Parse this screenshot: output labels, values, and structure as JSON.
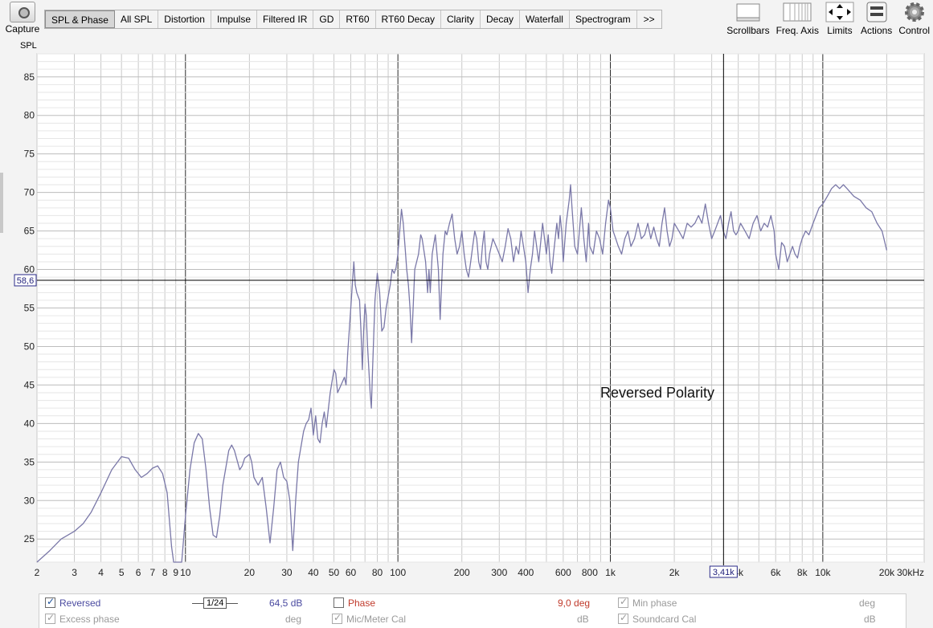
{
  "toolbar": {
    "capture_label": "Capture",
    "tabs": [
      "SPL & Phase",
      "All SPL",
      "Distortion",
      "Impulse",
      "Filtered IR",
      "GD",
      "RT60",
      "RT60 Decay",
      "Clarity",
      "Decay",
      "Waterfall",
      "Spectrogram"
    ],
    "more_label": ">>",
    "right": {
      "scrollbars": "Scrollbars",
      "freq_axis": "Freq. Axis",
      "limits": "Limits",
      "actions": "Actions",
      "control": "Control"
    }
  },
  "chart_data": {
    "type": "line",
    "ylabel": "SPL",
    "x_scale": "log",
    "xlim": [
      2,
      30000
    ],
    "ylim": [
      22,
      88
    ],
    "y_ticks": [
      25,
      30,
      35,
      40,
      45,
      50,
      55,
      60,
      65,
      70,
      75,
      80,
      85
    ],
    "x_tick_labels": [
      {
        "v": 2,
        "t": "2"
      },
      {
        "v": 3,
        "t": "3"
      },
      {
        "v": 4,
        "t": "4"
      },
      {
        "v": 5,
        "t": "5"
      },
      {
        "v": 6,
        "t": "6"
      },
      {
        "v": 7,
        "t": "7"
      },
      {
        "v": 8,
        "t": "8"
      },
      {
        "v": 9,
        "t": "9"
      },
      {
        "v": 10,
        "t": "10"
      },
      {
        "v": 20,
        "t": "20"
      },
      {
        "v": 30,
        "t": "30"
      },
      {
        "v": 40,
        "t": "40"
      },
      {
        "v": 50,
        "t": "50"
      },
      {
        "v": 60,
        "t": "60"
      },
      {
        "v": 80,
        "t": "80"
      },
      {
        "v": 100,
        "t": "100"
      },
      {
        "v": 200,
        "t": "200"
      },
      {
        "v": 300,
        "t": "300"
      },
      {
        "v": 400,
        "t": "400"
      },
      {
        "v": 600,
        "t": "600"
      },
      {
        "v": 800,
        "t": "800"
      },
      {
        "v": 1000,
        "t": "1k"
      },
      {
        "v": 2000,
        "t": "2k"
      },
      {
        "v": 4000,
        "t": "4k"
      },
      {
        "v": 6000,
        "t": "6k"
      },
      {
        "v": 8000,
        "t": "8k"
      },
      {
        "v": 10000,
        "t": "10k"
      },
      {
        "v": 20000,
        "t": "20k"
      },
      {
        "v": 30000,
        "t": "30kHz"
      }
    ],
    "annotation": "Reversed Polarity",
    "cursor": {
      "x": 3410,
      "y": 58.6,
      "x_label": "3,41k",
      "y_label": "58,6"
    },
    "series": [
      {
        "color": "#7a78a8",
        "points": [
          [
            2,
            22
          ],
          [
            2.3,
            23.5
          ],
          [
            2.6,
            25
          ],
          [
            3,
            26
          ],
          [
            3.3,
            27
          ],
          [
            3.6,
            28.5
          ],
          [
            4,
            31
          ],
          [
            4.5,
            34
          ],
          [
            5,
            35.7
          ],
          [
            5.4,
            35.5
          ],
          [
            5.8,
            34
          ],
          [
            6.2,
            33
          ],
          [
            6.6,
            33.5
          ],
          [
            7,
            34.2
          ],
          [
            7.4,
            34.5
          ],
          [
            7.8,
            33.5
          ],
          [
            8.2,
            31
          ],
          [
            8.6,
            24
          ],
          [
            8.8,
            21
          ],
          [
            9.6,
            21
          ],
          [
            10,
            28
          ],
          [
            10.5,
            34
          ],
          [
            11,
            37.5
          ],
          [
            11.5,
            38.7
          ],
          [
            12,
            38
          ],
          [
            12.5,
            34
          ],
          [
            13,
            29
          ],
          [
            13.5,
            25.5
          ],
          [
            14,
            25.2
          ],
          [
            14.5,
            28
          ],
          [
            15,
            32
          ],
          [
            16,
            36.5
          ],
          [
            16.5,
            37.2
          ],
          [
            17,
            36.5
          ],
          [
            18,
            34
          ],
          [
            18.5,
            34.5
          ],
          [
            19,
            35.5
          ],
          [
            20,
            36
          ],
          [
            20.5,
            35
          ],
          [
            21,
            33
          ],
          [
            22,
            32
          ],
          [
            23,
            33
          ],
          [
            24,
            29
          ],
          [
            25,
            24.5
          ],
          [
            26,
            29
          ],
          [
            27,
            34
          ],
          [
            28,
            35
          ],
          [
            29,
            33
          ],
          [
            30,
            32.5
          ],
          [
            31,
            30
          ],
          [
            32,
            23.5
          ],
          [
            33,
            30
          ],
          [
            34,
            35
          ],
          [
            36,
            39
          ],
          [
            37,
            40
          ],
          [
            38,
            40.5
          ],
          [
            39,
            42
          ],
          [
            40,
            38.5
          ],
          [
            41,
            41
          ],
          [
            42,
            38
          ],
          [
            43,
            37.5
          ],
          [
            44,
            40
          ],
          [
            45,
            41.5
          ],
          [
            46,
            39.5
          ],
          [
            48,
            44
          ],
          [
            50,
            47
          ],
          [
            51,
            46.5
          ],
          [
            52,
            44
          ],
          [
            54,
            45
          ],
          [
            56,
            46
          ],
          [
            57,
            45
          ],
          [
            58,
            49
          ],
          [
            60,
            55
          ],
          [
            61,
            58
          ],
          [
            62,
            61
          ],
          [
            63,
            58
          ],
          [
            64,
            57
          ],
          [
            66,
            56
          ],
          [
            67,
            52
          ],
          [
            68,
            47
          ],
          [
            69,
            52
          ],
          [
            70,
            55.5
          ],
          [
            71,
            54
          ],
          [
            72,
            50
          ],
          [
            74,
            44
          ],
          [
            75,
            42
          ],
          [
            76,
            47
          ],
          [
            78,
            56
          ],
          [
            80,
            59.5
          ],
          [
            82,
            57
          ],
          [
            84,
            52
          ],
          [
            86,
            52.5
          ],
          [
            88,
            55
          ],
          [
            92,
            58
          ],
          [
            94,
            60
          ],
          [
            96,
            59.5
          ],
          [
            98,
            60.2
          ],
          [
            100,
            62
          ],
          [
            102,
            65
          ],
          [
            104,
            67.8
          ],
          [
            106,
            66
          ],
          [
            108,
            63
          ],
          [
            110,
            60
          ],
          [
            112,
            58
          ],
          [
            114,
            55
          ],
          [
            116,
            50.5
          ],
          [
            118,
            55
          ],
          [
            120,
            60
          ],
          [
            125,
            62
          ],
          [
            128,
            64.5
          ],
          [
            130,
            64
          ],
          [
            135,
            61
          ],
          [
            138,
            57
          ],
          [
            140,
            60
          ],
          [
            142,
            57
          ],
          [
            145,
            62
          ],
          [
            150,
            64.5
          ],
          [
            155,
            60
          ],
          [
            158,
            53.5
          ],
          [
            160,
            57
          ],
          [
            163,
            62
          ],
          [
            167,
            65
          ],
          [
            170,
            64.5
          ],
          [
            175,
            66
          ],
          [
            180,
            67.2
          ],
          [
            185,
            64
          ],
          [
            190,
            62
          ],
          [
            195,
            63
          ],
          [
            200,
            65
          ],
          [
            205,
            62
          ],
          [
            210,
            60
          ],
          [
            215,
            59
          ],
          [
            220,
            61
          ],
          [
            225,
            63
          ],
          [
            230,
            65
          ],
          [
            235,
            64
          ],
          [
            240,
            61
          ],
          [
            245,
            60
          ],
          [
            250,
            63
          ],
          [
            255,
            65
          ],
          [
            260,
            61
          ],
          [
            265,
            60
          ],
          [
            270,
            62
          ],
          [
            280,
            64
          ],
          [
            290,
            63
          ],
          [
            300,
            62
          ],
          [
            310,
            61
          ],
          [
            320,
            63
          ],
          [
            330,
            65.3
          ],
          [
            340,
            64
          ],
          [
            350,
            61
          ],
          [
            360,
            63
          ],
          [
            370,
            62
          ],
          [
            380,
            65
          ],
          [
            390,
            63
          ],
          [
            400,
            61
          ],
          [
            410,
            57
          ],
          [
            420,
            60
          ],
          [
            430,
            62
          ],
          [
            440,
            65
          ],
          [
            450,
            63
          ],
          [
            460,
            61
          ],
          [
            480,
            66
          ],
          [
            490,
            64
          ],
          [
            500,
            62
          ],
          [
            510,
            64.5
          ],
          [
            520,
            61
          ],
          [
            530,
            59.5
          ],
          [
            540,
            62
          ],
          [
            560,
            66
          ],
          [
            570,
            64
          ],
          [
            580,
            67
          ],
          [
            590,
            65
          ],
          [
            600,
            61
          ],
          [
            620,
            66
          ],
          [
            640,
            69
          ],
          [
            650,
            71
          ],
          [
            660,
            68
          ],
          [
            680,
            63
          ],
          [
            700,
            62
          ],
          [
            720,
            66
          ],
          [
            730,
            68
          ],
          [
            750,
            64
          ],
          [
            770,
            61
          ],
          [
            790,
            66
          ],
          [
            800,
            63
          ],
          [
            830,
            62
          ],
          [
            860,
            65
          ],
          [
            890,
            64
          ],
          [
            920,
            62
          ],
          [
            950,
            66
          ],
          [
            980,
            69
          ],
          [
            1000,
            68
          ],
          [
            1030,
            65
          ],
          [
            1060,
            64
          ],
          [
            1090,
            63
          ],
          [
            1130,
            62
          ],
          [
            1170,
            64
          ],
          [
            1210,
            65
          ],
          [
            1250,
            63
          ],
          [
            1300,
            64
          ],
          [
            1350,
            66
          ],
          [
            1400,
            64
          ],
          [
            1450,
            64.5
          ],
          [
            1500,
            66
          ],
          [
            1550,
            64
          ],
          [
            1600,
            65.5
          ],
          [
            1650,
            64
          ],
          [
            1700,
            63
          ],
          [
            1750,
            66
          ],
          [
            1800,
            68
          ],
          [
            1850,
            65
          ],
          [
            1900,
            63
          ],
          [
            1950,
            64
          ],
          [
            2000,
            66
          ],
          [
            2100,
            65
          ],
          [
            2200,
            64
          ],
          [
            2300,
            66
          ],
          [
            2400,
            65.5
          ],
          [
            2500,
            66
          ],
          [
            2600,
            67
          ],
          [
            2700,
            66
          ],
          [
            2800,
            68.5
          ],
          [
            2900,
            66
          ],
          [
            3000,
            64
          ],
          [
            3100,
            65
          ],
          [
            3200,
            66
          ],
          [
            3300,
            67
          ],
          [
            3400,
            65
          ],
          [
            3500,
            64
          ],
          [
            3600,
            66
          ],
          [
            3700,
            67.5
          ],
          [
            3800,
            65
          ],
          [
            3900,
            64.5
          ],
          [
            4000,
            65
          ],
          [
            4100,
            66
          ],
          [
            4300,
            65
          ],
          [
            4500,
            64
          ],
          [
            4700,
            66
          ],
          [
            4900,
            67
          ],
          [
            5100,
            65
          ],
          [
            5300,
            66
          ],
          [
            5500,
            65.5
          ],
          [
            5700,
            67
          ],
          [
            5900,
            65
          ],
          [
            6000,
            62
          ],
          [
            6200,
            60
          ],
          [
            6400,
            63.5
          ],
          [
            6600,
            63
          ],
          [
            6800,
            61
          ],
          [
            7000,
            62
          ],
          [
            7200,
            63
          ],
          [
            7400,
            62
          ],
          [
            7600,
            61.5
          ],
          [
            7800,
            63
          ],
          [
            8000,
            64
          ],
          [
            8300,
            65
          ],
          [
            8600,
            64.5
          ],
          [
            9000,
            66
          ],
          [
            9300,
            67
          ],
          [
            9600,
            68
          ],
          [
            10000,
            68.5
          ],
          [
            10500,
            69.5
          ],
          [
            11000,
            70.5
          ],
          [
            11500,
            71
          ],
          [
            12000,
            70.5
          ],
          [
            12500,
            71
          ],
          [
            13000,
            70.5
          ],
          [
            14000,
            69.5
          ],
          [
            15000,
            69
          ],
          [
            16000,
            68
          ],
          [
            17000,
            67.5
          ],
          [
            18000,
            66
          ],
          [
            19000,
            65
          ],
          [
            20000,
            62.5
          ]
        ]
      }
    ]
  },
  "bottom": {
    "row1": {
      "reversed_label": "Reversed",
      "smoothing_value": "1/24",
      "spl_value": "64,5 dB",
      "phase_label": "Phase",
      "phase_value": "9,0 deg",
      "min_phase_label": "Min phase",
      "min_phase_unit": "deg"
    },
    "row2": {
      "excess_phase_label": "Excess phase",
      "excess_phase_unit": "deg",
      "mic_cal_label": "Mic/Meter Cal",
      "mic_cal_unit": "dB",
      "soundcard_cal_label": "Soundcard Cal",
      "soundcard_cal_unit": "dB"
    }
  }
}
